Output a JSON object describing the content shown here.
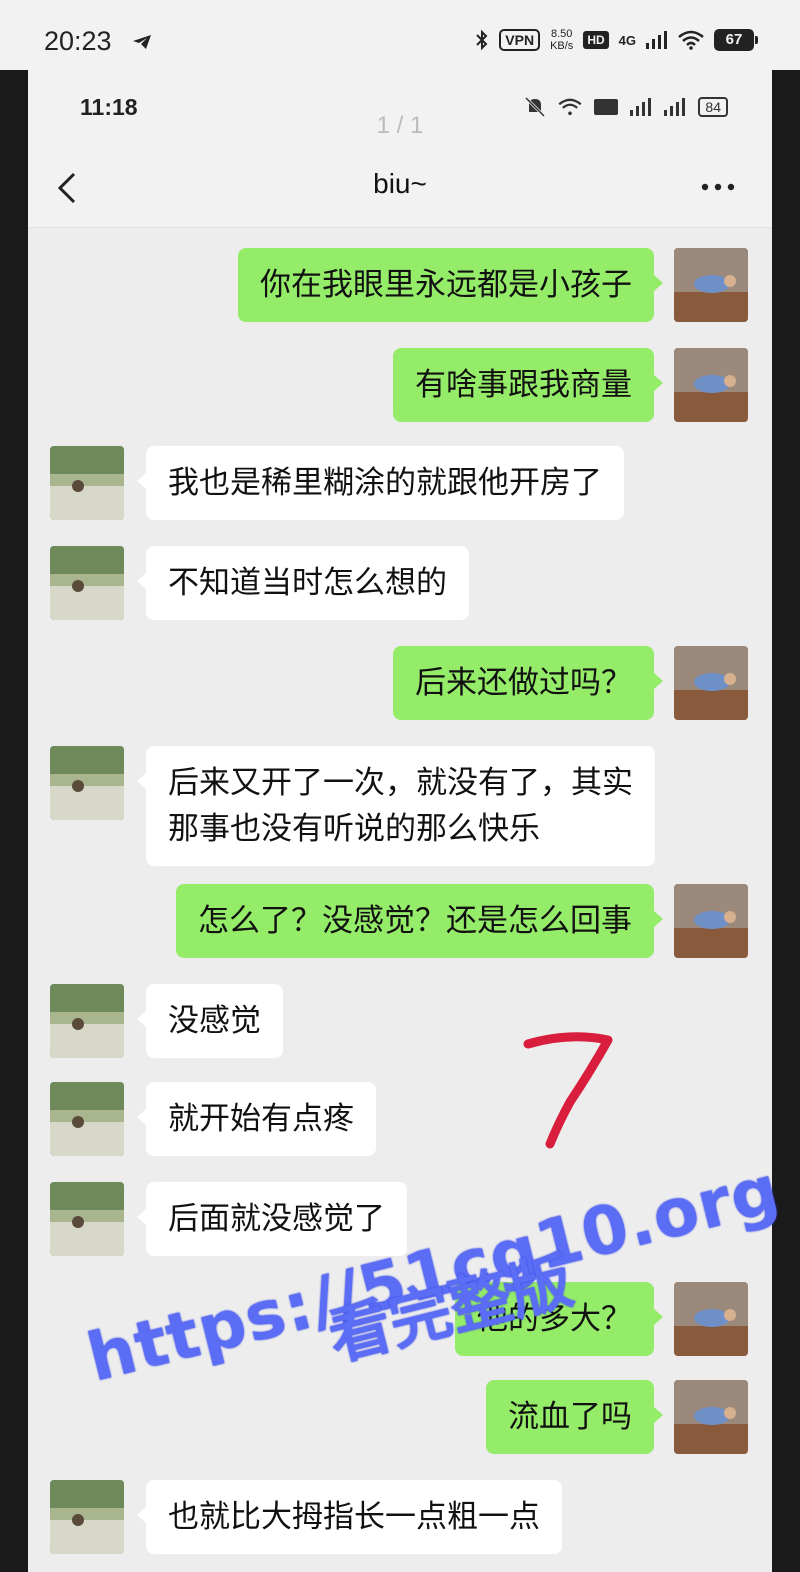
{
  "outer_status": {
    "time": "20:23",
    "vpn": "VPN",
    "speed_value": "8.50",
    "speed_unit": "KB/s",
    "hd": "HD",
    "network": "4G",
    "battery": "67"
  },
  "inner_status": {
    "time": "11:18",
    "battery": "84",
    "page_counter": "1 / 1"
  },
  "chat": {
    "title": "biu~"
  },
  "messages": [
    {
      "side": "me",
      "text": "你在我眼里永远都是小孩子"
    },
    {
      "side": "me",
      "text": "有啥事跟我商量"
    },
    {
      "side": "other",
      "text": "我也是稀里糊涂的就跟他开房了"
    },
    {
      "side": "other",
      "text": "不知道当时怎么想的"
    },
    {
      "side": "me",
      "text": "后来还做过吗？"
    },
    {
      "side": "other",
      "text": "后来又开了一次，就没有了，其实",
      "text2": "那事也没有听说的那么快乐"
    },
    {
      "side": "me",
      "text": "怎么了？没感觉？还是怎么回事"
    },
    {
      "side": "other",
      "text": "没感觉"
    },
    {
      "side": "other",
      "text": "就开始有点疼"
    },
    {
      "side": "other",
      "text": "后面就没感觉了"
    },
    {
      "side": "me",
      "text": "他的多大？"
    },
    {
      "side": "me",
      "text": "流血了吗"
    },
    {
      "side": "other",
      "text": "也就比大拇指长一点粗一点"
    }
  ],
  "watermark": {
    "url": "https://51cg10.org",
    "text": "看完整版"
  },
  "colors": {
    "my_bubble": "#95ec69",
    "their_bubble": "#ffffff",
    "chat_background": "#ededed",
    "watermark": "#5b6cf5",
    "annotation": "#d81e3c"
  }
}
